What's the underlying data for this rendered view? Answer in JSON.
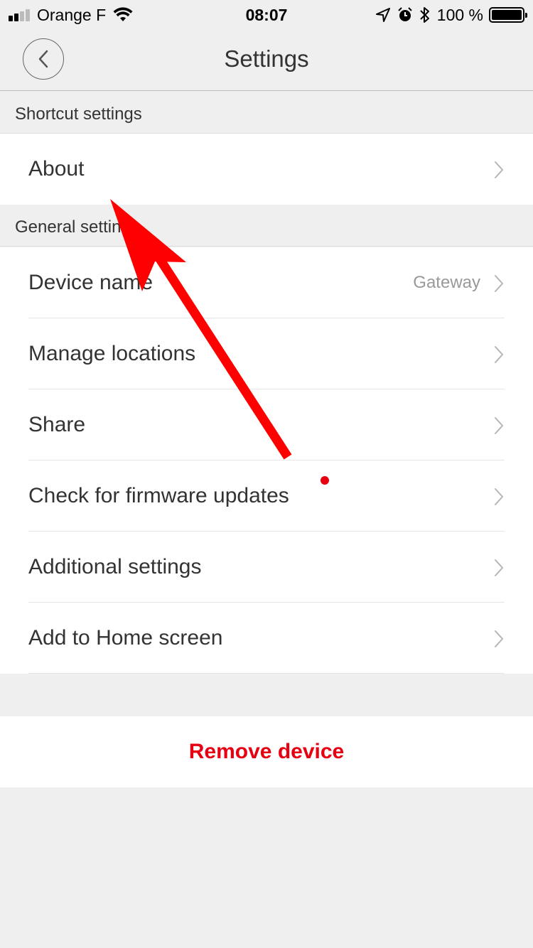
{
  "status_bar": {
    "carrier": "Orange F",
    "time": "08:07",
    "battery": "100 %"
  },
  "nav": {
    "title": "Settings"
  },
  "sections": {
    "shortcut": {
      "header": "Shortcut settings",
      "items": [
        {
          "label": "About"
        }
      ]
    },
    "general": {
      "header": "General settings",
      "items": [
        {
          "label": "Device name",
          "value": "Gateway"
        },
        {
          "label": "Manage locations"
        },
        {
          "label": "Share"
        },
        {
          "label": "Check for firmware updates"
        },
        {
          "label": "Additional settings"
        },
        {
          "label": "Add to Home screen"
        }
      ]
    }
  },
  "remove": {
    "label": "Remove device"
  },
  "colors": {
    "accent_red": "#e60012",
    "background": "#efefef",
    "annotation_arrow": "#ff0000"
  }
}
